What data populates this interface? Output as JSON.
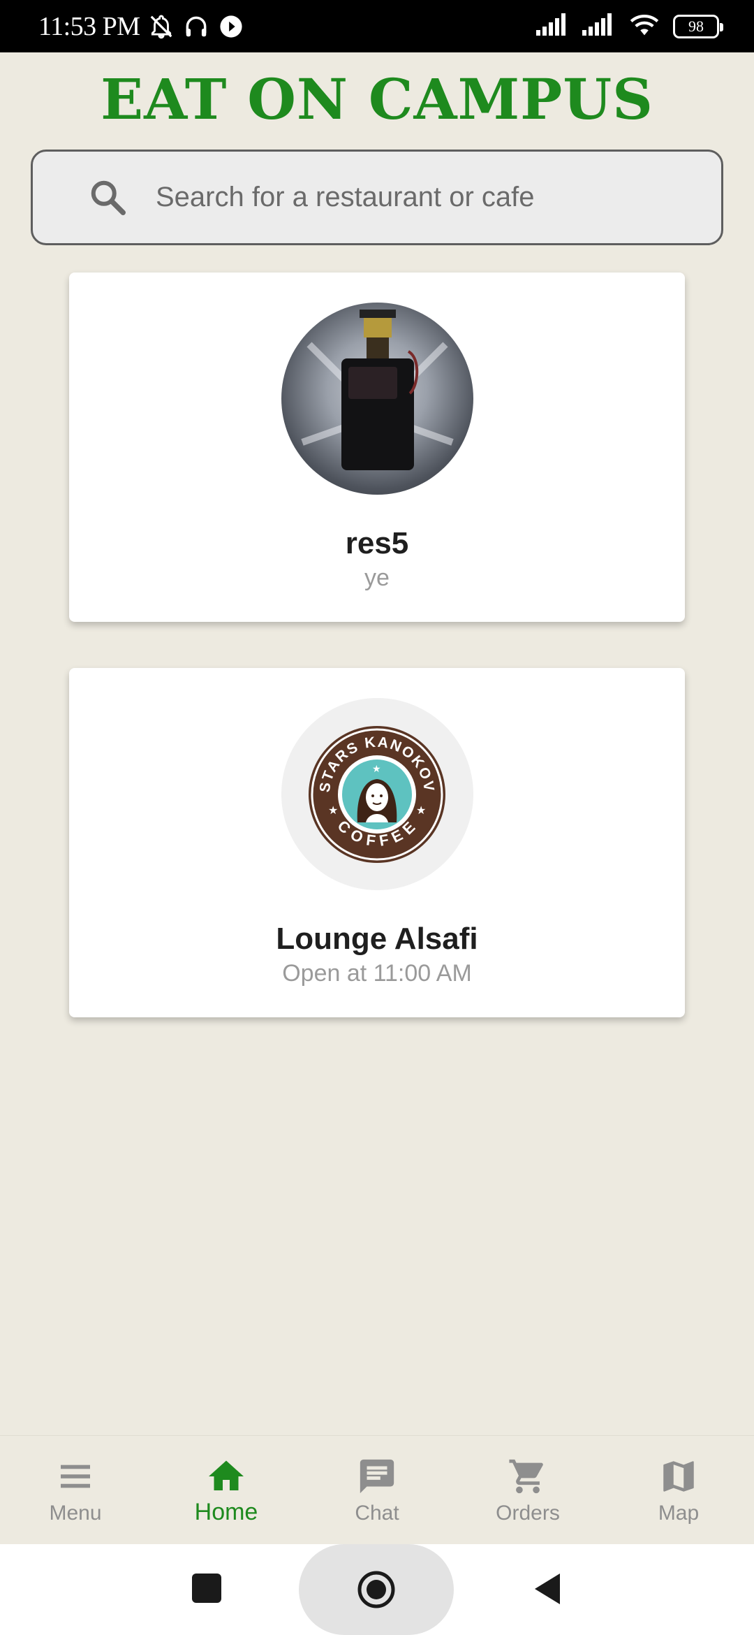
{
  "status_bar": {
    "time": "11:53 PM",
    "battery": "98",
    "icons": [
      "bell-muted-icon",
      "headphones-icon",
      "play-icon",
      "signal-icon",
      "signal-icon",
      "wifi-icon",
      "battery-icon"
    ]
  },
  "header": {
    "title": "EAT ON CAMPUS"
  },
  "search": {
    "placeholder": "Search for a restaurant or cafe",
    "value": ""
  },
  "restaurants": [
    {
      "name": "res5",
      "subtitle": "ye"
    },
    {
      "name": "Lounge Alsafi",
      "subtitle": "Open at 11:00 AM",
      "logo_text": [
        "STARS KANOKOV",
        "COFFEE"
      ]
    }
  ],
  "bottom_nav": {
    "active": "Home",
    "active_color": "#1E8A1E",
    "items": [
      {
        "label": "Menu",
        "icon": "menu-icon"
      },
      {
        "label": "Home",
        "icon": "home-icon"
      },
      {
        "label": "Chat",
        "icon": "chat-icon"
      },
      {
        "label": "Orders",
        "icon": "cart-icon"
      },
      {
        "label": "Map",
        "icon": "map-icon"
      }
    ]
  },
  "colors": {
    "background": "#EDEAE0",
    "brand_green": "#1E8A1E",
    "inactive": "#8E8E8E"
  }
}
